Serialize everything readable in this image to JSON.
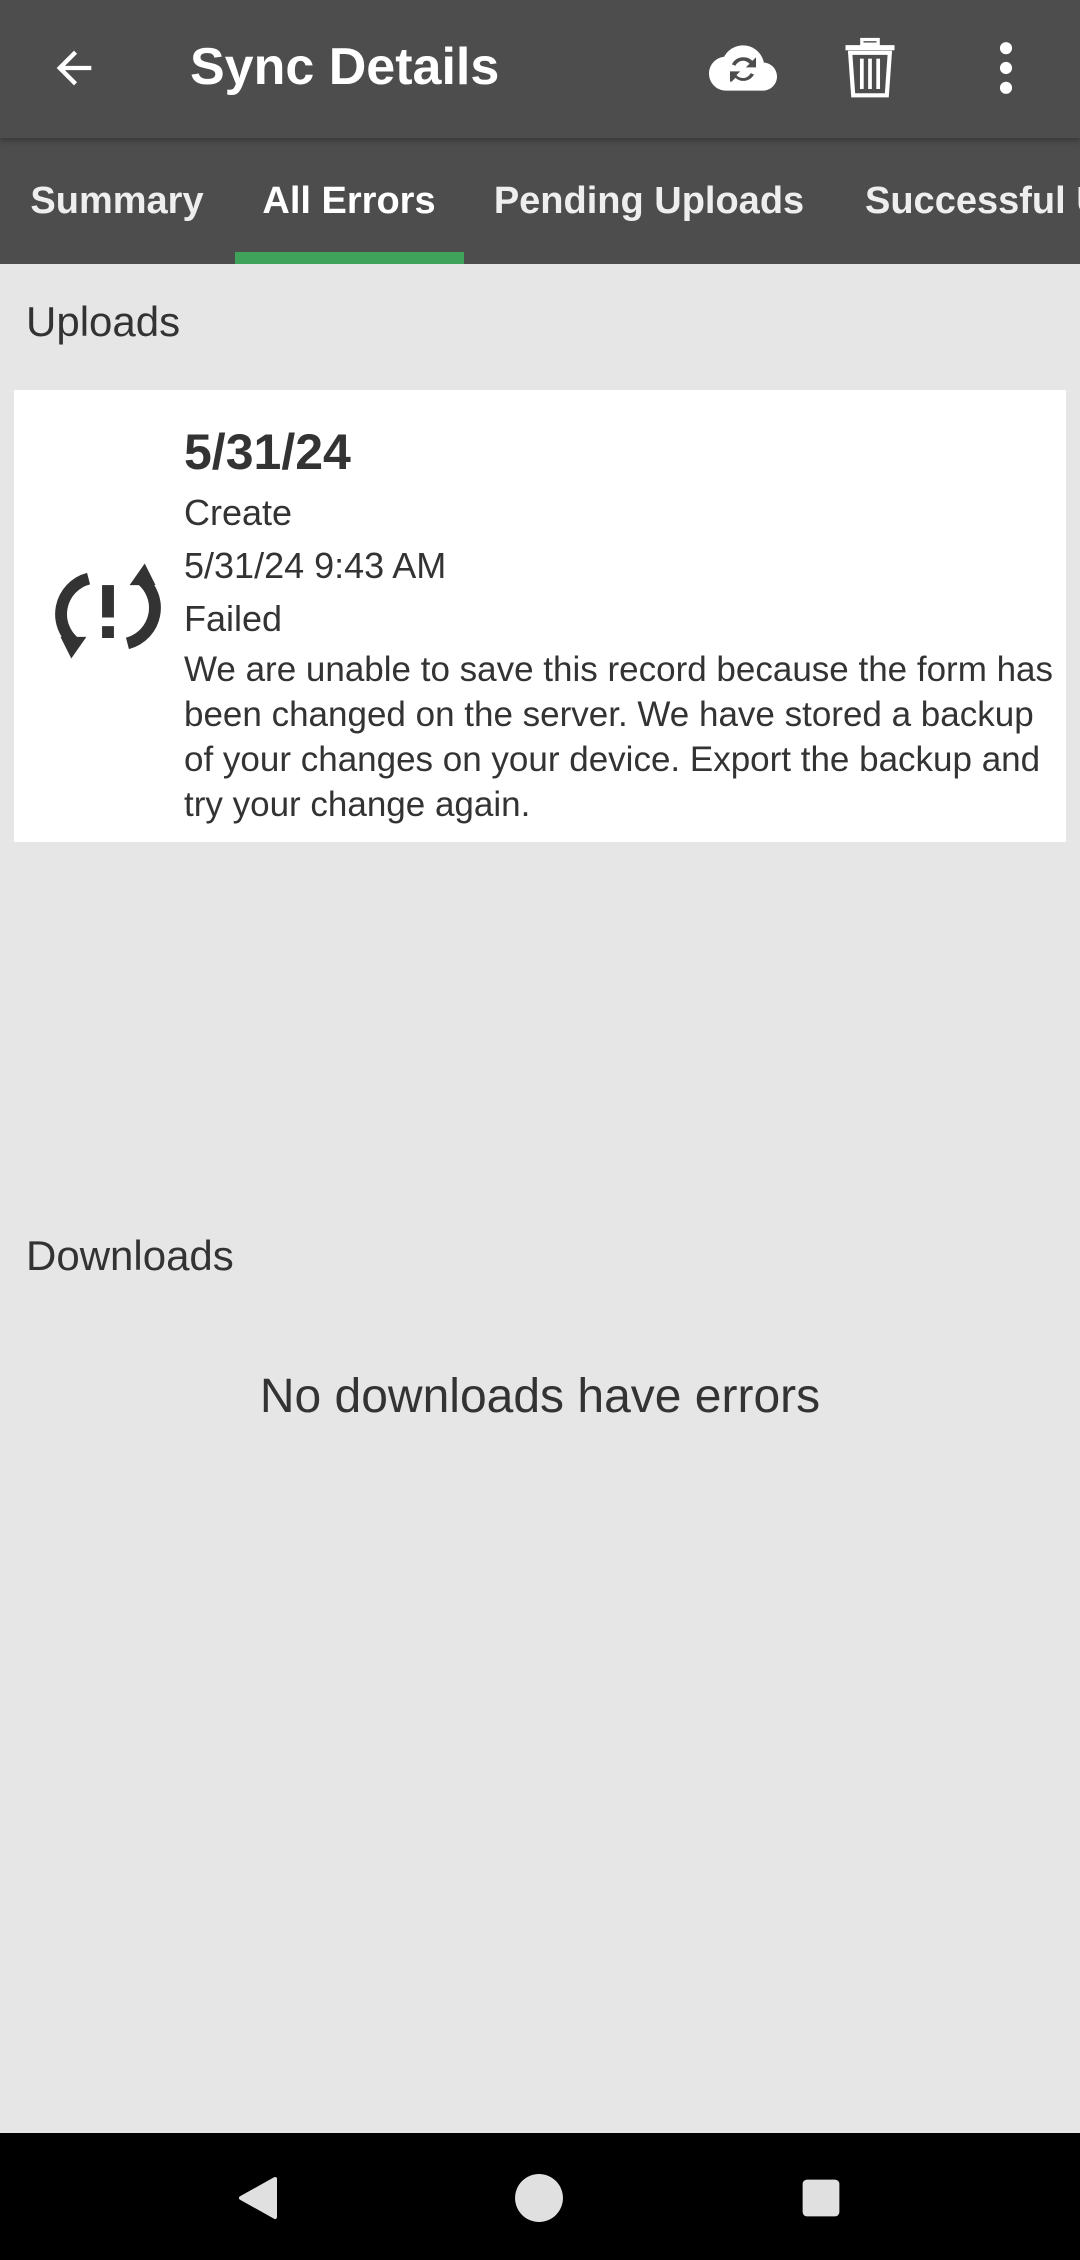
{
  "app_bar": {
    "title": "Sync Details",
    "icons": {
      "back": "arrow-left-icon",
      "sync": "cloud-sync-icon",
      "delete": "trash-icon",
      "more": "more-vert-icon"
    }
  },
  "tabs": [
    {
      "label": "Summary",
      "selected": false
    },
    {
      "label": "All Errors",
      "selected": true
    },
    {
      "label": "Pending Uploads",
      "selected": false
    },
    {
      "label": "Successful U",
      "selected": false
    }
  ],
  "colors": {
    "bar": "#4d4d4d",
    "indicator": "#3fa35b",
    "background": "#e6e6e6",
    "card": "#ffffff",
    "text": "#333333"
  },
  "uploads": {
    "header": "Uploads",
    "items": [
      {
        "icon": "sync-error-icon",
        "date": "5/31/24",
        "action": "Create",
        "timestamp": "5/31/24 9:43 AM",
        "status": "Failed",
        "message": "We are unable to save this record because the form has been changed on the server. We have stored a backup of your changes on your device. Export the backup and try your change again."
      }
    ]
  },
  "downloads": {
    "header": "Downloads",
    "empty_text": "No downloads have errors"
  },
  "nav": {
    "back": "nav-back-icon",
    "home": "nav-home-icon",
    "recents": "nav-recents-icon"
  }
}
